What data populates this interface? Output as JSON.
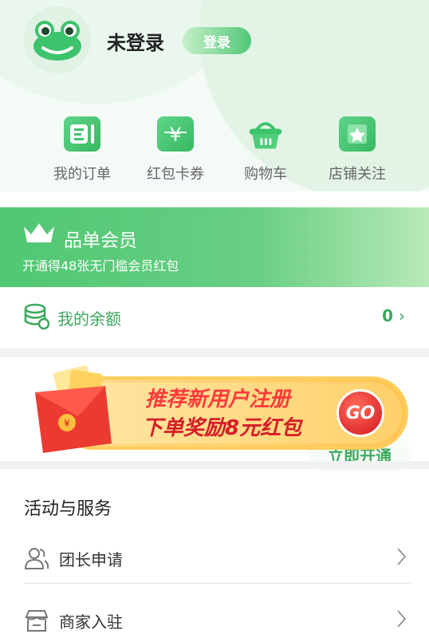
{
  "user": {
    "name": "未登录",
    "login_label": "登录"
  },
  "quick_actions": [
    {
      "label": "我的订单",
      "icon": "orders-icon"
    },
    {
      "label": "红包卡券",
      "icon": "coupon-icon"
    },
    {
      "label": "购物车",
      "icon": "basket-icon"
    },
    {
      "label": "店铺关注",
      "icon": "star-shop-icon"
    }
  ],
  "member": {
    "title": "品单会员",
    "subtitle": "开通得48张无门槛会员红包",
    "button": "立即开通"
  },
  "balance": {
    "label": "我的余额",
    "value": "0"
  },
  "promo": {
    "line1": "推荐新用户注册",
    "line2": "下单奖励8元红包",
    "go": "GO"
  },
  "services": {
    "title": "活动与服务",
    "items": [
      {
        "label": "团长申请"
      },
      {
        "label": "商家入驻"
      }
    ]
  },
  "colors": {
    "accent": "#3aa95d",
    "promo_red": "#e0202a"
  }
}
